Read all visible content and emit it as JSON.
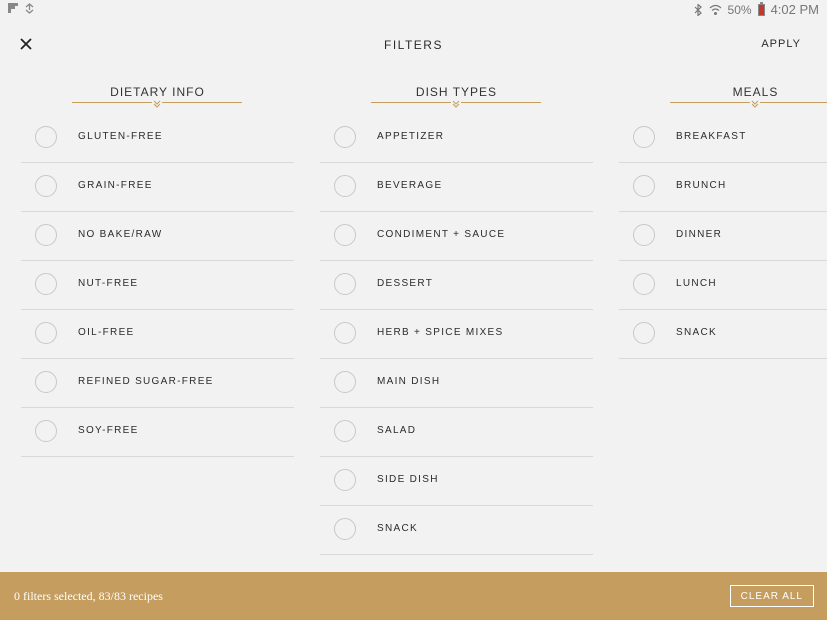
{
  "status": {
    "battery_text": "50%",
    "time": "4:02 PM"
  },
  "header": {
    "title": "FILTERS",
    "apply_label": "APPLY"
  },
  "columns": [
    {
      "title": "DIETARY INFO",
      "options": [
        "GLUTEN-FREE",
        "GRAIN-FREE",
        "NO BAKE/RAW",
        "NUT-FREE",
        "OIL-FREE",
        "REFINED SUGAR-FREE",
        "SOY-FREE"
      ]
    },
    {
      "title": "DISH TYPES",
      "options": [
        "APPETIZER",
        "BEVERAGE",
        "CONDIMENT + SAUCE",
        "DESSERT",
        "HERB + SPICE MIXES",
        "MAIN DISH",
        "SALAD",
        "SIDE DISH",
        "SNACK"
      ]
    },
    {
      "title": "MEALS",
      "options": [
        "BREAKFAST",
        "BRUNCH",
        "DINNER",
        "LUNCH",
        "SNACK"
      ]
    }
  ],
  "footer": {
    "summary": "0 filters selected, 83/83 recipes",
    "clear_label": "CLEAR ALL"
  },
  "colors": {
    "accent": "#c49d5f",
    "background": "#f2f2f2"
  }
}
